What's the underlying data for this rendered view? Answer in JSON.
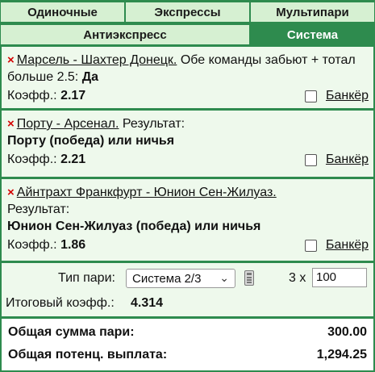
{
  "tabs": {
    "row1": [
      {
        "label": "Одиночные",
        "active": false
      },
      {
        "label": "Экспрессы",
        "active": false
      },
      {
        "label": "Мультипари",
        "active": false
      }
    ],
    "row2": [
      {
        "label": "Антиэкспресс",
        "active": false
      },
      {
        "label": "Система",
        "active": true
      }
    ]
  },
  "bets": [
    {
      "remove_icon": "×",
      "match": "Марсель - Шахтер Донецк.",
      "market": "Обе команды забьют + тотал больше 2.5:",
      "selection": "Да",
      "odds_label": "Коэфф.:",
      "odds": "2.17",
      "banker_label": "Банкёр",
      "banker_checked": false
    },
    {
      "remove_icon": "×",
      "match": "Порту - Арсенал.",
      "market": "Результат:",
      "selection": "Порту (победа) или ничья",
      "odds_label": "Коэфф.:",
      "odds": "2.21",
      "banker_label": "Банкёр",
      "banker_checked": false
    },
    {
      "remove_icon": "×",
      "match": "Айнтрахт Франкфурт - Юнион Сен-Жилуаз.",
      "market": "Результат:",
      "selection": "Юнион Сен-Жилуаз (победа) или ничья",
      "odds_label": "Коэфф.:",
      "odds": "1.86",
      "banker_label": "Банкёр",
      "banker_checked": false
    }
  ],
  "system": {
    "type_label": "Тип пари:",
    "selected": "Система 2/3",
    "multiplier": "3 x",
    "stake": "100",
    "total_odds_label": "Итоговый коэфф.:",
    "total_odds": "4.314"
  },
  "summary": {
    "total_stake_label": "Общая сумма пари:",
    "total_stake": "300.00",
    "potential_label": "Общая потенц. выплата:",
    "potential": "1,294.25"
  },
  "colors": {
    "accent": "#2e8b4e",
    "tab_bg": "#d6f0d2",
    "panel_bg": "#eef9ec",
    "remove": "#d40000"
  }
}
